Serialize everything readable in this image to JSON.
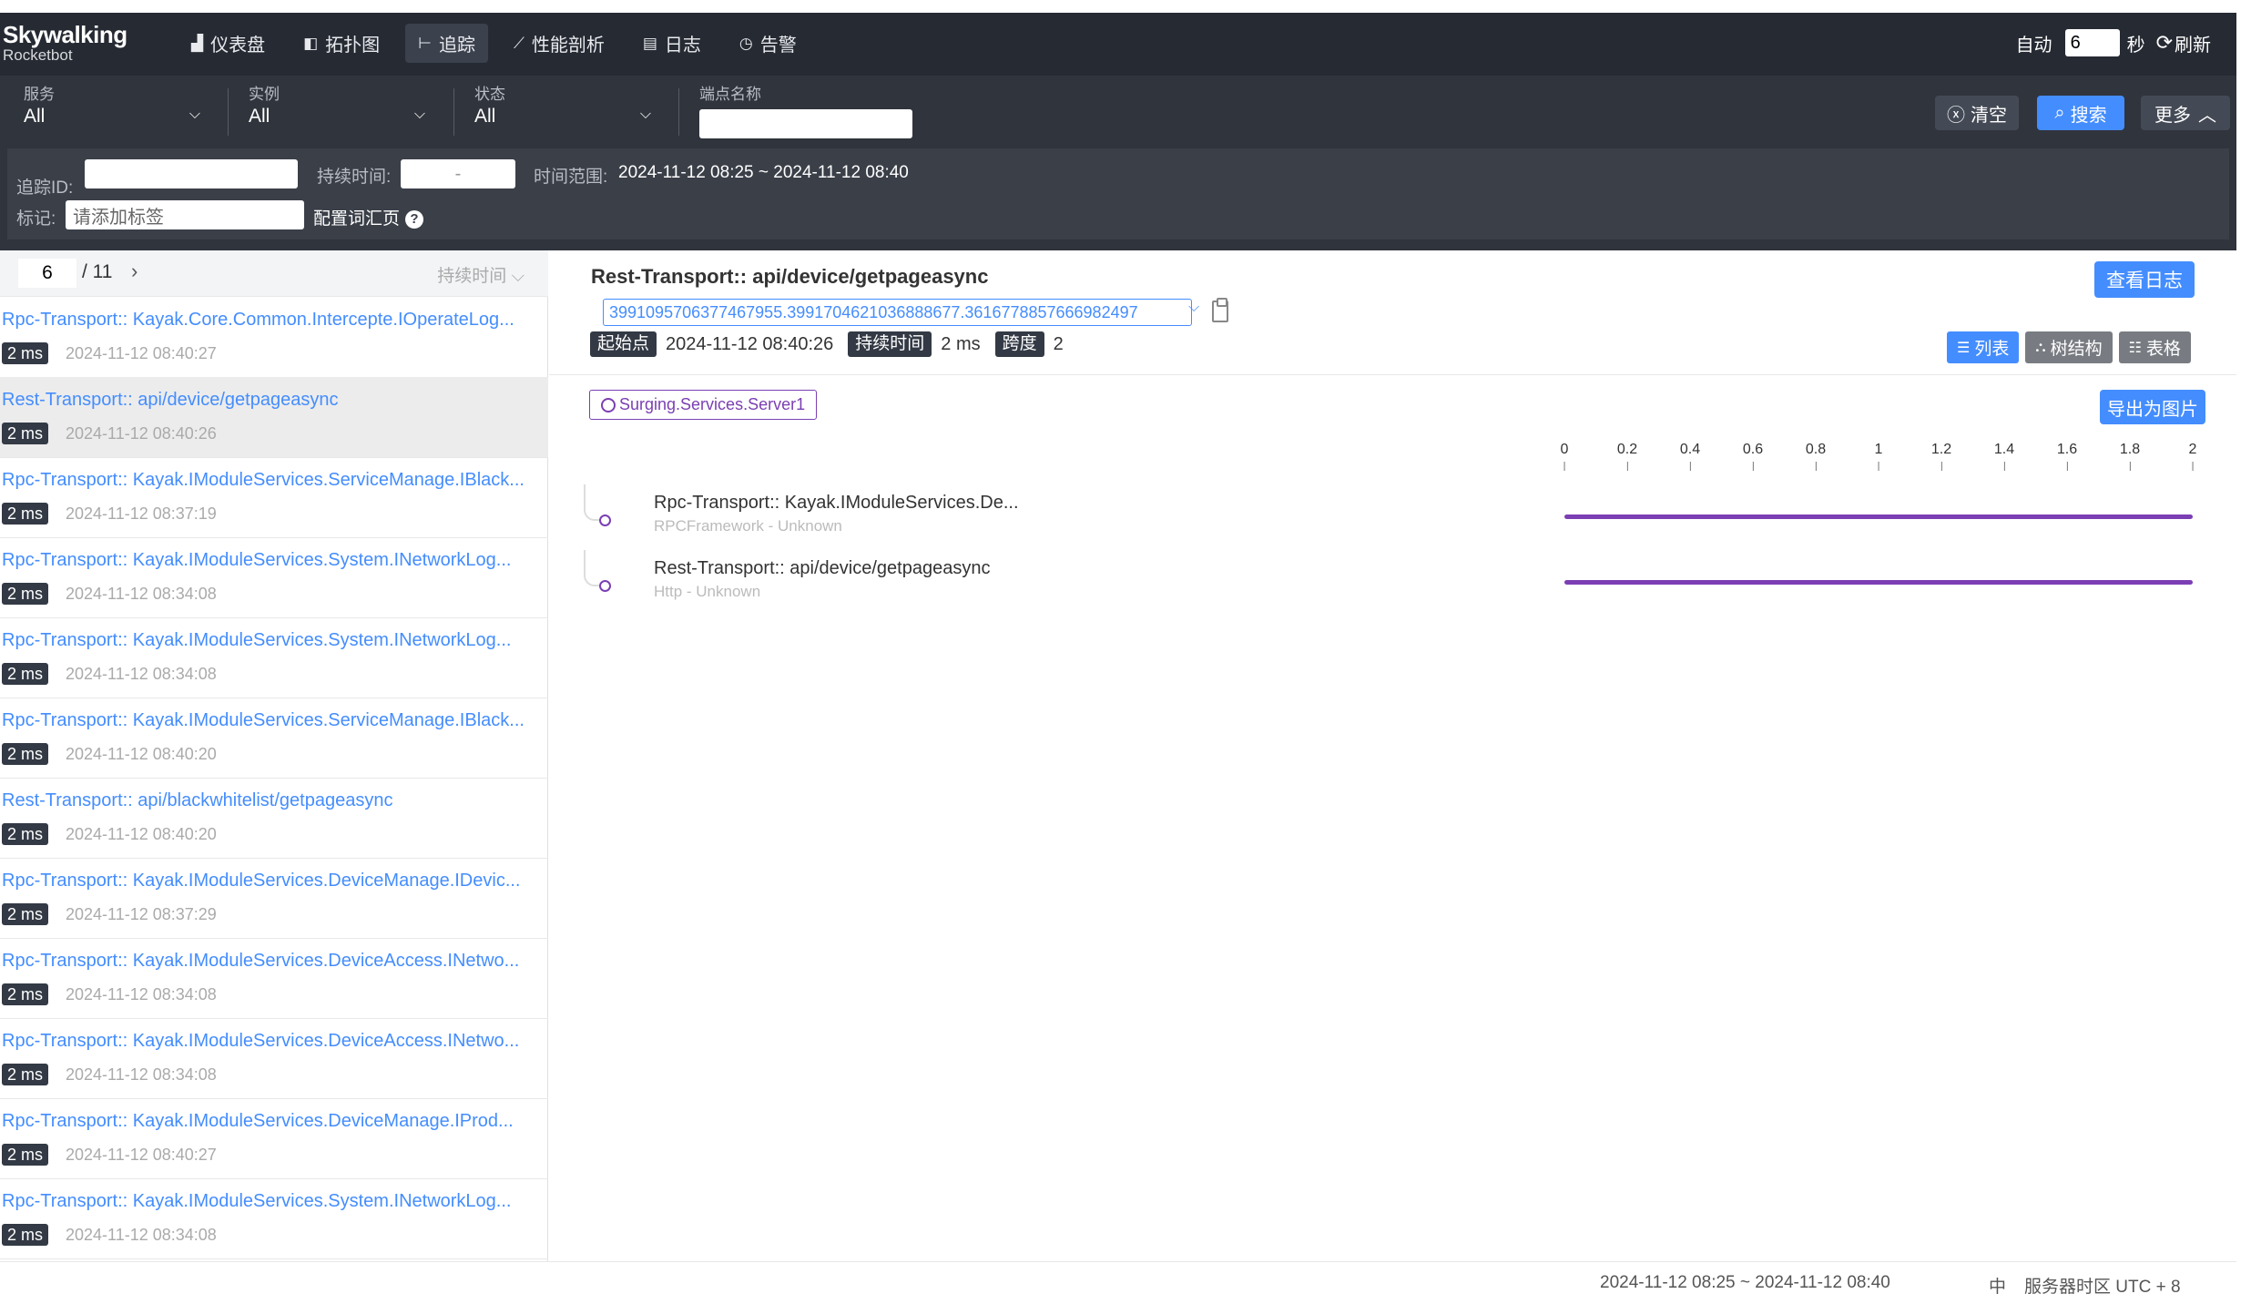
{
  "brand": {
    "name": "Skywalking",
    "sub": "Rocketbot"
  },
  "nav": [
    {
      "label": "仪表盘",
      "icon": "dashboard-icon",
      "glyph": "▟",
      "active": false
    },
    {
      "label": "拓扑图",
      "icon": "topology-icon",
      "glyph": "◧",
      "active": false
    },
    {
      "label": "追踪",
      "icon": "trace-icon",
      "glyph": "⊢",
      "active": true
    },
    {
      "label": "性能剖析",
      "icon": "profile-icon",
      "glyph": "⟋",
      "active": false
    },
    {
      "label": "日志",
      "icon": "log-icon",
      "glyph": "▤",
      "active": false
    },
    {
      "label": "告警",
      "icon": "alarm-icon",
      "glyph": "◷",
      "active": false
    }
  ],
  "auto_refresh": {
    "label": "自动",
    "interval": "6",
    "unit": "秒",
    "refresh_label": "刷新"
  },
  "filters": {
    "service": {
      "label": "服务",
      "value": "All"
    },
    "instance": {
      "label": "实例",
      "value": "All"
    },
    "status": {
      "label": "状态",
      "value": "All"
    },
    "endpoint": {
      "label": "端点名称",
      "value": ""
    },
    "clear_label": "清空",
    "search_label": "搜索",
    "more_label": "更多",
    "trace_id_label": "追踪ID:",
    "duration_label": "持续时间:",
    "duration_placeholder": "-",
    "time_range_label": "时间范围:",
    "time_range": "2024-11-12 08:25 ~ 2024-11-12 08:40",
    "tags_label": "标记:",
    "tags_placeholder": "请添加标签",
    "config_label": "配置词汇页"
  },
  "pager": {
    "current": "6",
    "total": "/ 11",
    "sort_label": "持续时间"
  },
  "traces": [
    {
      "name": "Rpc-Transport:: Kayak.Core.Common.Intercepte.IOperateLog...",
      "duration": "2 ms",
      "time": "2024-11-12 08:40:27",
      "selected": false
    },
    {
      "name": "Rest-Transport:: api/device/getpageasync",
      "duration": "2 ms",
      "time": "2024-11-12 08:40:26",
      "selected": true
    },
    {
      "name": "Rpc-Transport:: Kayak.IModuleServices.ServiceManage.IBlack...",
      "duration": "2 ms",
      "time": "2024-11-12 08:37:19",
      "selected": false
    },
    {
      "name": "Rpc-Transport:: Kayak.IModuleServices.System.INetworkLog...",
      "duration": "2 ms",
      "time": "2024-11-12 08:34:08",
      "selected": false
    },
    {
      "name": "Rpc-Transport:: Kayak.IModuleServices.System.INetworkLog...",
      "duration": "2 ms",
      "time": "2024-11-12 08:34:08",
      "selected": false
    },
    {
      "name": "Rpc-Transport:: Kayak.IModuleServices.ServiceManage.IBlack...",
      "duration": "2 ms",
      "time": "2024-11-12 08:40:20",
      "selected": false
    },
    {
      "name": "Rest-Transport:: api/blackwhitelist/getpageasync",
      "duration": "2 ms",
      "time": "2024-11-12 08:40:20",
      "selected": false
    },
    {
      "name": "Rpc-Transport:: Kayak.IModuleServices.DeviceManage.IDevic...",
      "duration": "2 ms",
      "time": "2024-11-12 08:37:29",
      "selected": false
    },
    {
      "name": "Rpc-Transport:: Kayak.IModuleServices.DeviceAccess.INetwo...",
      "duration": "2 ms",
      "time": "2024-11-12 08:34:08",
      "selected": false
    },
    {
      "name": "Rpc-Transport:: Kayak.IModuleServices.DeviceAccess.INetwo...",
      "duration": "2 ms",
      "time": "2024-11-12 08:34:08",
      "selected": false
    },
    {
      "name": "Rpc-Transport:: Kayak.IModuleServices.DeviceManage.IProd...",
      "duration": "2 ms",
      "time": "2024-11-12 08:40:27",
      "selected": false
    },
    {
      "name": "Rpc-Transport:: Kayak.IModuleServices.System.INetworkLog...",
      "duration": "2 ms",
      "time": "2024-11-12 08:34:08",
      "selected": false
    }
  ],
  "detail": {
    "title": "Rest-Transport:: api/device/getpageasync",
    "view_logs_label": "查看日志",
    "trace_id": "399109570637746795​5.3991704621036888677.3616778857666982497",
    "start_label": "起始点",
    "start_time": "2024-11-12 08:40:26",
    "duration_label": "持续时间",
    "duration": "2 ms",
    "span_label": "跨度",
    "span_count": "2",
    "view_list": "列表",
    "view_tree": "树结构",
    "view_table": "表格",
    "service_tag": "Surging.Services.Server1",
    "export_label": "导出为图片",
    "accent": "#448dfe",
    "span_color": "#7b3fb3"
  },
  "timeline": {
    "ticks": [
      "0",
      "0.2",
      "0.4",
      "0.6",
      "0.8",
      "1",
      "1.2",
      "1.4",
      "1.6",
      "1.8",
      "2"
    ],
    "min": 0,
    "max": 2,
    "spans": [
      {
        "name": "Rpc-Transport:: Kayak.IModuleServices.De...",
        "layer": "RPCFramework - Unknown",
        "start": 0,
        "end": 2
      },
      {
        "name": "Rest-Transport:: api/device/getpageasync",
        "layer": "Http - Unknown",
        "start": 0,
        "end": 2
      }
    ]
  },
  "footer": {
    "time_range": "2024-11-12 08:25 ~ 2024-11-12 08:40",
    "lang": "中",
    "timezone": "服务器时区 UTC + 8"
  }
}
